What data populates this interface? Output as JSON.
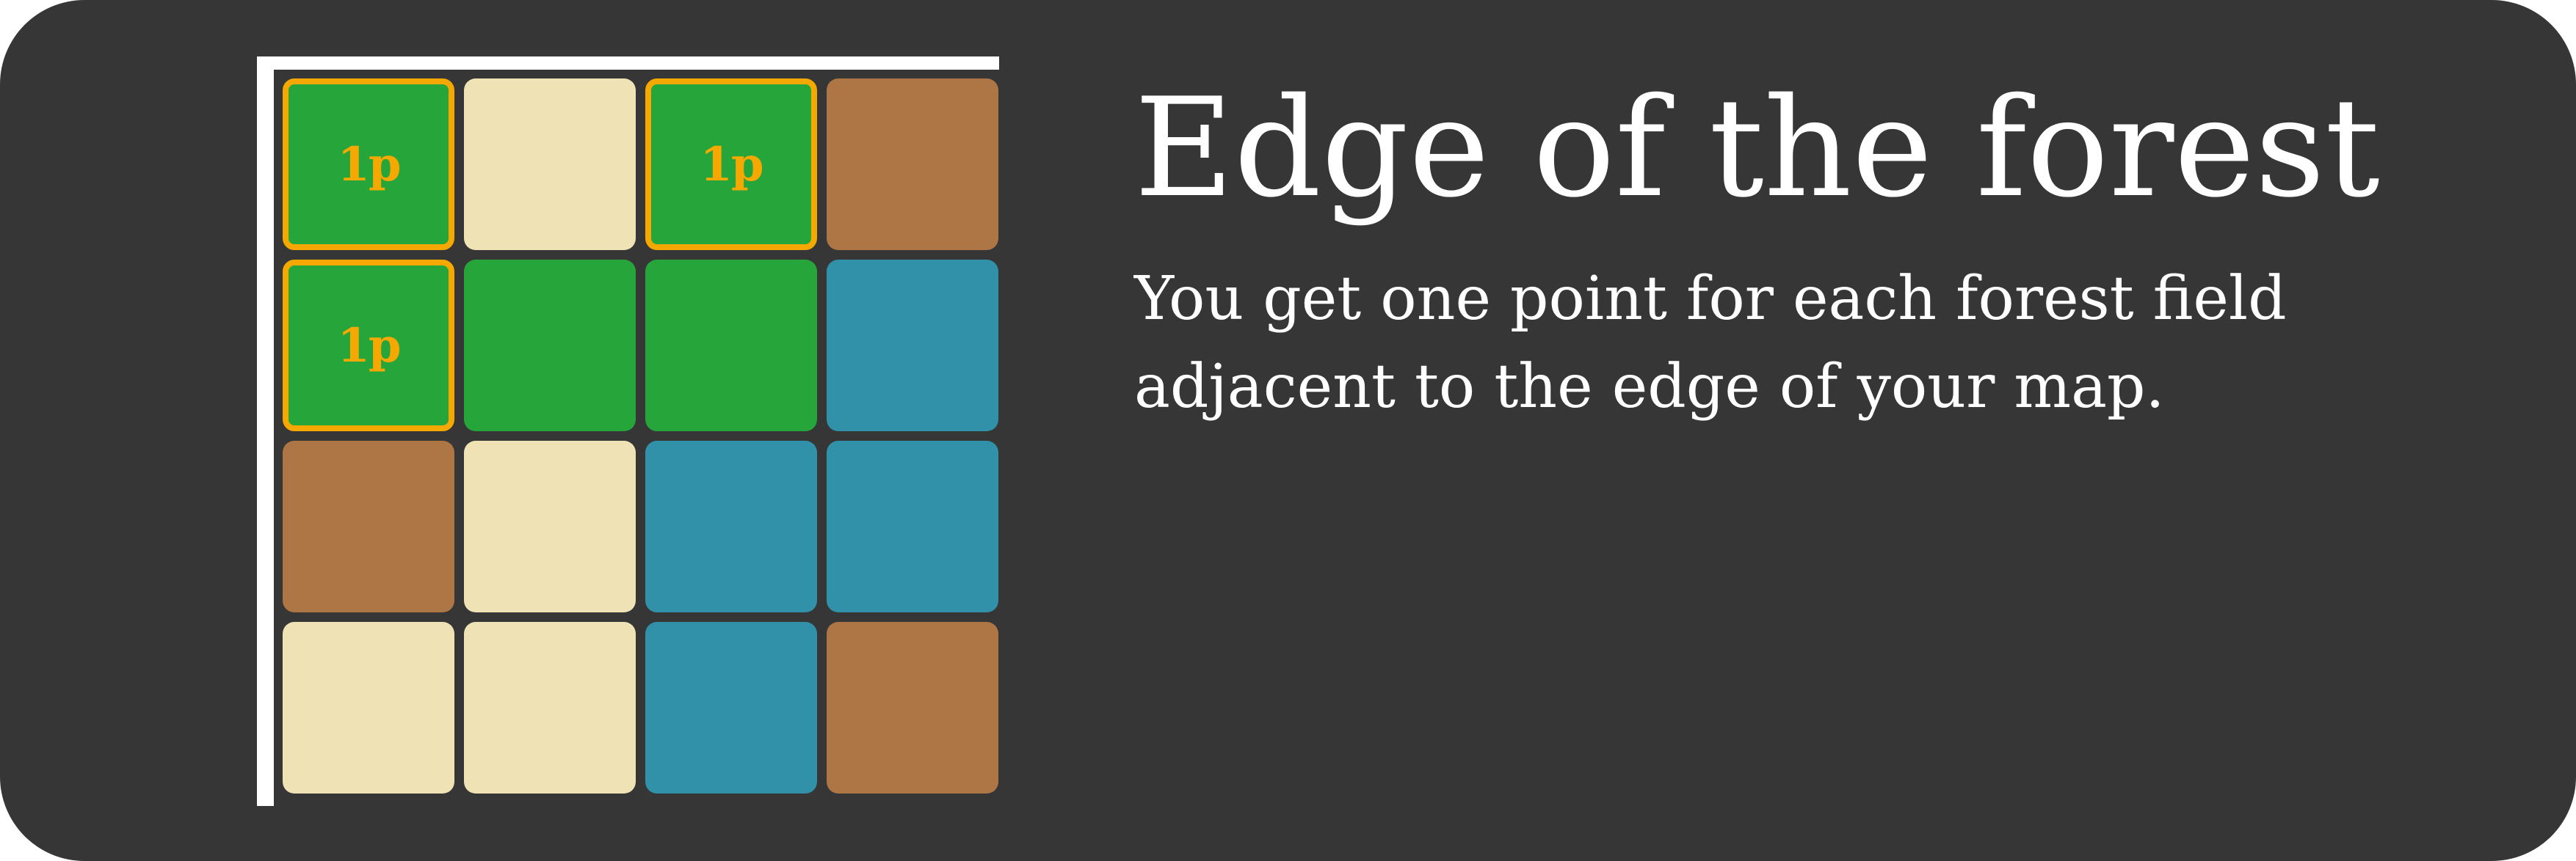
{
  "card": {
    "title": "Edge of the forest",
    "description": "You get one point for each forest field adjacent to the edge of your map."
  },
  "colors": {
    "background": "#363636",
    "forest": "#26a53b",
    "plains": "#efe2b5",
    "village": "#ae7644",
    "water": "#3091a9",
    "highlight": "#f5a800",
    "edge": "#ffffff"
  },
  "map": {
    "rows": [
      [
        {
          "terrain": "forest",
          "points": "1p"
        },
        {
          "terrain": "plains",
          "points": ""
        },
        {
          "terrain": "forest",
          "points": "1p"
        },
        {
          "terrain": "village",
          "points": ""
        }
      ],
      [
        {
          "terrain": "forest",
          "points": "1p"
        },
        {
          "terrain": "forest",
          "points": ""
        },
        {
          "terrain": "forest",
          "points": ""
        },
        {
          "terrain": "water",
          "points": ""
        }
      ],
      [
        {
          "terrain": "village",
          "points": ""
        },
        {
          "terrain": "plains",
          "points": ""
        },
        {
          "terrain": "water",
          "points": ""
        },
        {
          "terrain": "water",
          "points": ""
        }
      ],
      [
        {
          "terrain": "plains",
          "points": ""
        },
        {
          "terrain": "plains",
          "points": ""
        },
        {
          "terrain": "water",
          "points": ""
        },
        {
          "terrain": "village",
          "points": ""
        }
      ]
    ]
  }
}
